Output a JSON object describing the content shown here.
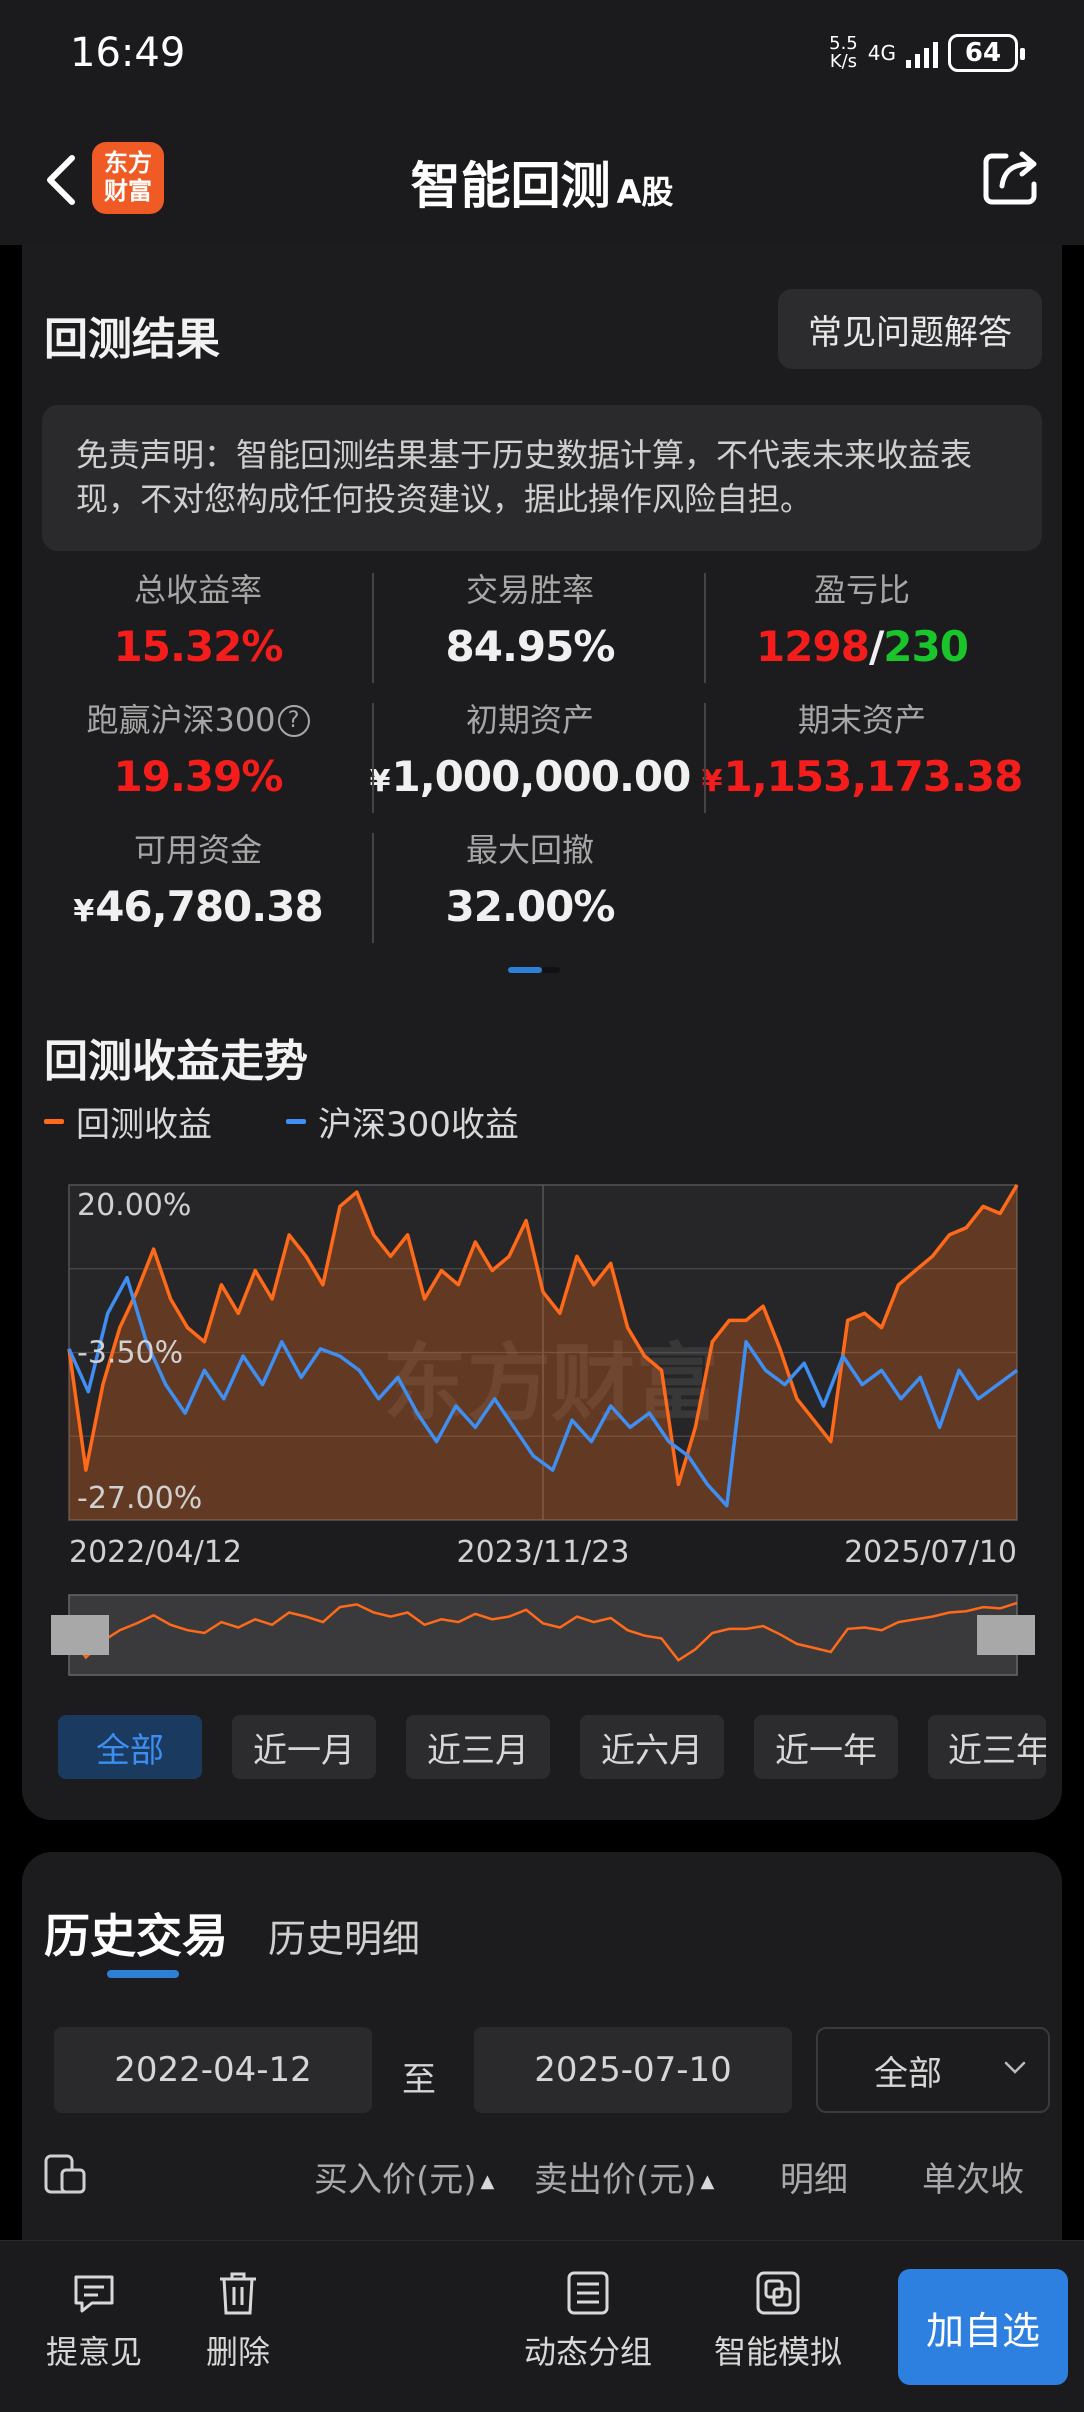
{
  "status": {
    "time": "16:49",
    "net_speed_top": "5.5",
    "net_speed_bottom": "K/s",
    "network": "4G",
    "battery": "64"
  },
  "nav": {
    "logo_line1": "东方",
    "logo_line2": "财富",
    "title": "智能回测",
    "title_suffix": "A股"
  },
  "results": {
    "title": "回测结果",
    "faq_label": "常见问题解答",
    "disclaimer": "免责声明：智能回测结果基于历史数据计算，不代表未来收益表现，不对您构成任何投资建议，据此操作风险自担。",
    "stats": [
      {
        "label": "总收益率",
        "value": "15.32%"
      },
      {
        "label": "交易胜率",
        "value": "84.95%"
      },
      {
        "label": "盈亏比",
        "value_win": "1298",
        "separator": "/",
        "value_loss": "230"
      },
      {
        "label": "跑赢沪深300",
        "value": "19.39%"
      },
      {
        "label": "初期资产",
        "currency": "¥",
        "value": "1,000,000.00"
      },
      {
        "label": "期末资产",
        "currency": "¥",
        "value": "1,153,173.38"
      },
      {
        "label": "可用资金",
        "currency": "¥",
        "value": "46,780.38"
      },
      {
        "label": "最大回撤",
        "value": "32.00%"
      }
    ],
    "help_icon": "question-circle-icon"
  },
  "trend": {
    "title": "回测收益走势",
    "watermark": "东方财富",
    "range_tabs": [
      "全部",
      "近一月",
      "近三月",
      "近六月",
      "近一年",
      "近三年"
    ],
    "active_tab": 0
  },
  "chart_data": {
    "type": "area",
    "x_ticks": [
      "2022/04/12",
      "2023/11/23",
      "2025/07/10"
    ],
    "y_ticks": [
      "20.00%",
      "-3.50%",
      "-27.00%"
    ],
    "ylim": [
      -27,
      20
    ],
    "grid": true,
    "legend_position": "top-left",
    "series": [
      {
        "name": "回测收益",
        "color": "#ff6a1a",
        "values": [
          -3,
          -20,
          -8,
          0,
          5,
          11,
          4,
          0,
          -2,
          6,
          2,
          8,
          4,
          13,
          10,
          6,
          17,
          19,
          13,
          10,
          13,
          4,
          8,
          6,
          12,
          8,
          10,
          15,
          5,
          2,
          10,
          6,
          9,
          0,
          -4,
          -6,
          -22,
          -14,
          -2,
          1,
          1,
          3,
          -3,
          -10,
          -13,
          -16,
          1,
          2,
          0,
          6,
          8,
          10,
          13,
          14,
          17,
          16,
          20
        ]
      },
      {
        "name": "沪深300收益",
        "color": "#3f8ef2",
        "values": [
          -3,
          -9,
          2,
          7,
          -2,
          -8,
          -12,
          -6,
          -10,
          -4,
          -8,
          -2,
          -7,
          -3,
          -4,
          -6,
          -10,
          -7,
          -12,
          -16,
          -11,
          -14,
          -10,
          -14,
          -18,
          -20,
          -13,
          -16,
          -11,
          -14,
          -12,
          -16,
          -18,
          -22,
          -25,
          -2,
          -6,
          -8,
          -5,
          -11,
          -4,
          -8,
          -6,
          -10,
          -7,
          -14,
          -6,
          -10,
          -8,
          -6
        ]
      }
    ]
  },
  "history": {
    "tab_active": "历史交易",
    "tab_other": "历史明细",
    "start_date": "2022-04-12",
    "to_label": "至",
    "end_date": "2025-07-10",
    "filter": "全部",
    "columns": [
      "买入价(元)",
      "卖出价(元)",
      "明细",
      "单次收"
    ]
  },
  "bottom": {
    "feedback": "提意见",
    "delete": "删除",
    "dynamic_group": "动态分组",
    "simulate": "智能模拟",
    "add_watch": "加自选"
  }
}
